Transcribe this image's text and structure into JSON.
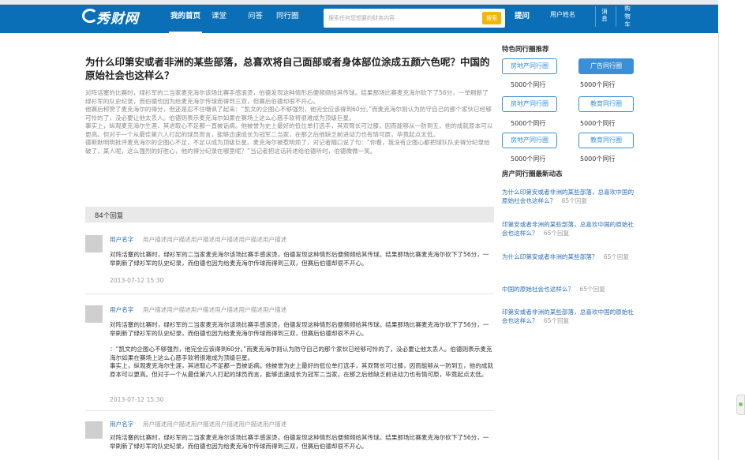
{
  "nav": {
    "logo": "秀财网",
    "items": [
      "我的首页",
      "课堂",
      "问答",
      "同行圈"
    ],
    "search_placeholder": "搜索任何您想要的财务内容",
    "search_button": "搜索",
    "ask": "提问",
    "user": "用户姓名",
    "messages": "消息",
    "cart": "购物车"
  },
  "question": {
    "title": "为什么印第安或者非洲的某些部落，总喜欢将自己面部或者身体部位涂成五颜六色呢？中国的原始社会也这样么？",
    "paragraphs": [
      "对阵活塞的比赛时，绿衫军的二当家麦克海尔该场比赛手感滚烫，伯德发现这种情形后便频频给其传球。结果那场比赛麦克海尔砍下了56分，一举刷新了绿衫军的队史纪录，而伯德也因为给麦克海尔传球而得到三双，但赛后伯德却很不开心。",
      "他赛后称赞了麦克海尔的得分，但还是忍不住嘲讽了起来：“凯文的企图心不够强烈，他完全应该得到60分。”而麦克海尔则认为防守自己的那个家伙已经够可怜的了，没必要让他太丢人。伯德则表示麦克海尔如果在赛场上这么心慈手软将很难成为顶级巨星。",
      "事实上，纵观麦克海尔生涯，其进取心不足都一直被诟病。他被誉为史上最好的低位单打选手，其双臂长可过膝，因而能够从一防到五，他的成就原本可以更高。但对于一个从最佳第六人打起的球员而言，能够迅速成长为冠军二当家，在那之后他缺乏前进动力也有情可原，毕竟起点太低。",
      "德斯默明明批评麦克海尔的企图心不足，不足以成为顶级巨星。麦克海尔被惹明烦了，对记者随口说了句：“你看，我没有企图心都把球队队史得分纪录给破了，某人呢，这么强烈的好胜心，他的得分纪录在哪里呢？”当记者把这话转述给伯德听时，伯德微微一笑。"
    ]
  },
  "reply_count": "84个回复",
  "answers": [
    {
      "user": "用户名字",
      "desc": "用户描述用户描述用户描述用户描述用户描述用户描述",
      "paragraphs": [
        "对阵活塞的比赛时，绿衫军的二当家麦克海尔该场比赛手感滚烫，伯德发现这种情形后便频频给其传球。结果那场比赛麦克海尔砍下了56分，一举刷新了绿衫军的队史纪录，而伯德也因为给麦克海尔传球而得到三双，但赛后伯德却很不开心。"
      ],
      "date": "2013-07-12  15:30"
    },
    {
      "user": "用户名字",
      "desc": "用户描述用户描述用户描述用户描述用户描述用户描述",
      "paragraphs": [
        "对阵活塞的比赛时，绿衫军的二当家麦克海尔该场比赛手感滚烫，伯德发现这种情形后便频频给其传球。结果那场比赛麦克海尔砍下了56分，一举刷新了绿衫军的队史纪录，而伯德也因为给麦克海尔传球而得到三双，但赛后伯德却很不开心。",
        "：“凯文的企图心不够强烈，他完全应该得到60分。”而麦克海尔则认为防守自己的那个家伙已经够可怜的了，没必要让他太丢人。伯德则表示麦克海尔如果在赛场上这么心慈手软将很难成为顶级巨星。",
        "事实上，纵观麦克海尔生涯，其进取心不足都一直被诟病。他被誉为史上最好的低位单打选手，其双臂长可过膝，因而能够从一防到五，他的成就原本可以更高。但对于一个从最佳第六人打起的球员而言，能够迅速成长为冠军二当家，在那之后他缺乏前进动力也有情可原，毕竟起点太低。"
      ],
      "date": "2013-07-12  15:30"
    },
    {
      "user": "用户名字",
      "desc": "用户描述用户描述用户描述用户描述用户描述用户描述",
      "paragraphs": [
        "对阵活塞的比赛时，绿衫军的二当家麦克海尔该场比赛手感滚烫，伯德发现这种情形后便频频给其传球。结果那场比赛麦克海尔砍下了56分，一举刷新了绿衫军的队史纪录，而伯德也因为给麦克海尔传球而得到三双，但赛后伯德却很不开心。"
      ],
      "date": ""
    }
  ],
  "sidebar": {
    "recommend_title": "特色同行圈推荐",
    "circles": [
      {
        "label": "房地产同行圈",
        "count": "5000个同行"
      },
      {
        "label": "广告同行圈",
        "count": "5000个同行"
      },
      {
        "label": "房地产同行圈",
        "count": "5000个同行"
      },
      {
        "label": "教育同行圈",
        "count": "5000个同行"
      },
      {
        "label": "房地产同行圈",
        "count": "5000个同行"
      },
      {
        "label": "教育同行圈",
        "count": "5000个同行"
      }
    ],
    "dynamic_title": "房产同行圈最新动态",
    "dynamics": [
      {
        "title": "为什么印第安或者非洲的某些部落，总喜欢中国的原始社会也这样么？",
        "count": "65个回复"
      },
      {
        "title": "印第安或者非洲的某些部落，总喜欢中国的原始社会也这样么？",
        "count": "65个回复"
      },
      {
        "title": "为什么印第安或者非洲的某些部落？",
        "count": "65个回复"
      },
      {
        "title": "中国的原始社会也这样么？",
        "count": "65个回复"
      },
      {
        "title": "印第安或者非洲的某些部落，总喜欢中国的原始社会也这样么？",
        "count": "65个回复"
      }
    ]
  },
  "colors": {
    "nav_bg": "#0b6fb8",
    "accent": "#3a8fd6",
    "search_button": "#f2b705"
  }
}
